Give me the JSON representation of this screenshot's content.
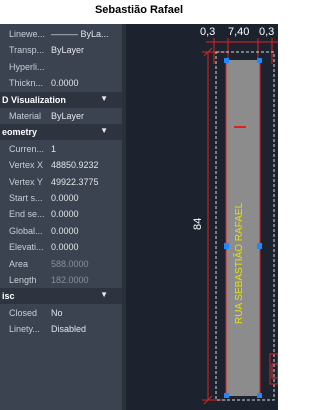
{
  "caption": "Sebastião Rafael",
  "properties": {
    "top_rows": [
      {
        "key": "Linewe...",
        "value": "——— ByLa..."
      },
      {
        "key": "Transp...",
        "value": "ByLayer"
      },
      {
        "key": "Hyperli...",
        "value": ""
      },
      {
        "key": "Thickn...",
        "value": "0.0000"
      }
    ],
    "sections": [
      {
        "title": "D Visualization",
        "rows": [
          {
            "key": "Material",
            "value": "ByLayer"
          }
        ]
      },
      {
        "title": "eometry",
        "rows": [
          {
            "key": "Curren...",
            "value": "1"
          },
          {
            "key": "Vertex X",
            "value": "48850.9232"
          },
          {
            "key": "Vertex Y",
            "value": "49922.3775"
          },
          {
            "key": "Start s...",
            "value": "0.0000"
          },
          {
            "key": "End se...",
            "value": "0.0000"
          },
          {
            "key": "Global...",
            "value": "0.0000"
          },
          {
            "key": "Elevati...",
            "value": "0.0000"
          },
          {
            "key": "Area",
            "value": "588.0000"
          },
          {
            "key": "Length",
            "value": "182.0000"
          }
        ]
      },
      {
        "title": "isc",
        "rows": [
          {
            "key": "Closed",
            "value": "No"
          },
          {
            "key": "Linety...",
            "value": "Disabled"
          }
        ]
      }
    ]
  },
  "drawing": {
    "dim_left": "0,3",
    "dim_mid": "7,40",
    "dim_right": "0,3",
    "dim_vertical": "84",
    "street_label": "RUA SEBASTIÃO RAFAEL",
    "colors": {
      "dimension": "#e02020",
      "street_text": "#e8e000",
      "road_fill": "#8c8c8c",
      "grip": "#1e88ff"
    }
  }
}
